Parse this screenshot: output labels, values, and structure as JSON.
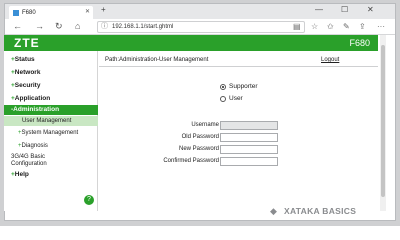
{
  "browser": {
    "tab_title": "F680",
    "url": "192.168.1.1/start.ghtml"
  },
  "router": {
    "logo": "ZTE",
    "model": "F680"
  },
  "sidebar": {
    "items": [
      {
        "label": "Status"
      },
      {
        "label": "Network"
      },
      {
        "label": "Security"
      },
      {
        "label": "Application"
      },
      {
        "label": "Administration"
      }
    ],
    "sub_items": [
      {
        "label": "User Management"
      },
      {
        "label": "System Management"
      },
      {
        "label": "Diagnosis"
      },
      {
        "label": "3G/4G Basic"
      },
      {
        "label": "Configuration"
      }
    ],
    "help_label": "Help",
    "help_dot": "?"
  },
  "main": {
    "path": "Path:Administration-User Management",
    "logout": "Logout",
    "radios": [
      {
        "label": "Supporter",
        "selected": true
      },
      {
        "label": "User",
        "selected": false
      }
    ],
    "fields": {
      "username_label": "Username",
      "old_password_label": "Old Password",
      "new_password_label": "New Password",
      "confirm_password_label": "Confirmed Password"
    }
  },
  "watermark": "XATAKA BASICS",
  "colors": {
    "brand_green": "#2aa02a",
    "selected_sub_bg": "#c9e7c3"
  }
}
